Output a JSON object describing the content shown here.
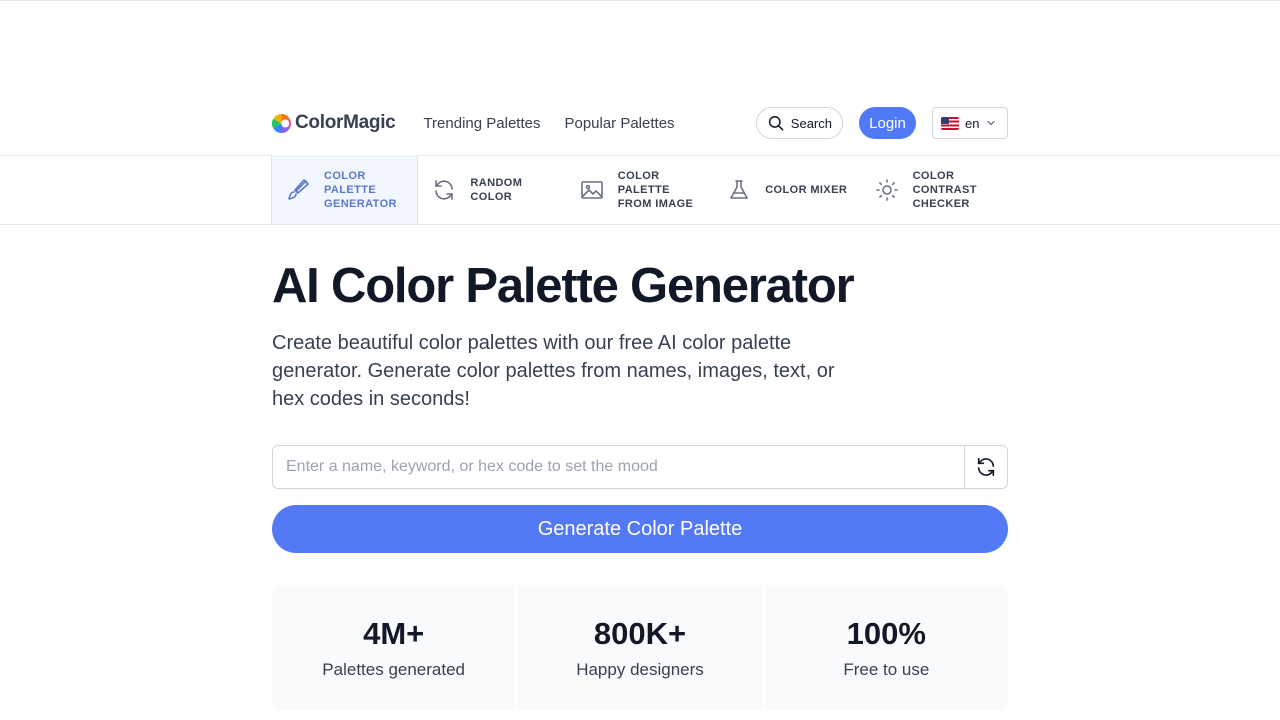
{
  "header": {
    "logo_text": "ColorMagic",
    "nav": [
      {
        "label": "Trending Palettes"
      },
      {
        "label": "Popular Palettes"
      }
    ],
    "search_label": "Search",
    "login_label": "Login",
    "language": "en"
  },
  "tools": [
    {
      "label": "COLOR\nPALETTE\nGENERATOR",
      "icon": "brush-icon",
      "active": true
    },
    {
      "label": "RANDOM\nCOLOR",
      "icon": "refresh-icon",
      "active": false
    },
    {
      "label": "COLOR\nPALETTE\nFROM IMAGE",
      "icon": "image-icon",
      "active": false
    },
    {
      "label": "COLOR MIXER",
      "icon": "flask-icon",
      "active": false
    },
    {
      "label": "COLOR\nCONTRAST\nCHECKER",
      "icon": "sun-icon",
      "active": false
    }
  ],
  "hero": {
    "title": "AI Color Palette Generator",
    "subtitle": "Create beautiful color palettes with our free AI color palette generator. Generate color palettes from names, images, text, or hex codes in seconds!",
    "input_placeholder": "Enter a name, keyword, or hex code to set the mood",
    "input_value": "",
    "generate_label": "Generate Color Palette"
  },
  "stats": [
    {
      "value": "4M+",
      "label": "Palettes generated"
    },
    {
      "value": "800K+",
      "label": "Happy designers"
    },
    {
      "value": "100%",
      "label": "Free to use"
    }
  ],
  "colors": {
    "accent": "#5479f7",
    "active_tab_bg": "#f2f6ff",
    "active_tab_text": "#5a79c8"
  }
}
